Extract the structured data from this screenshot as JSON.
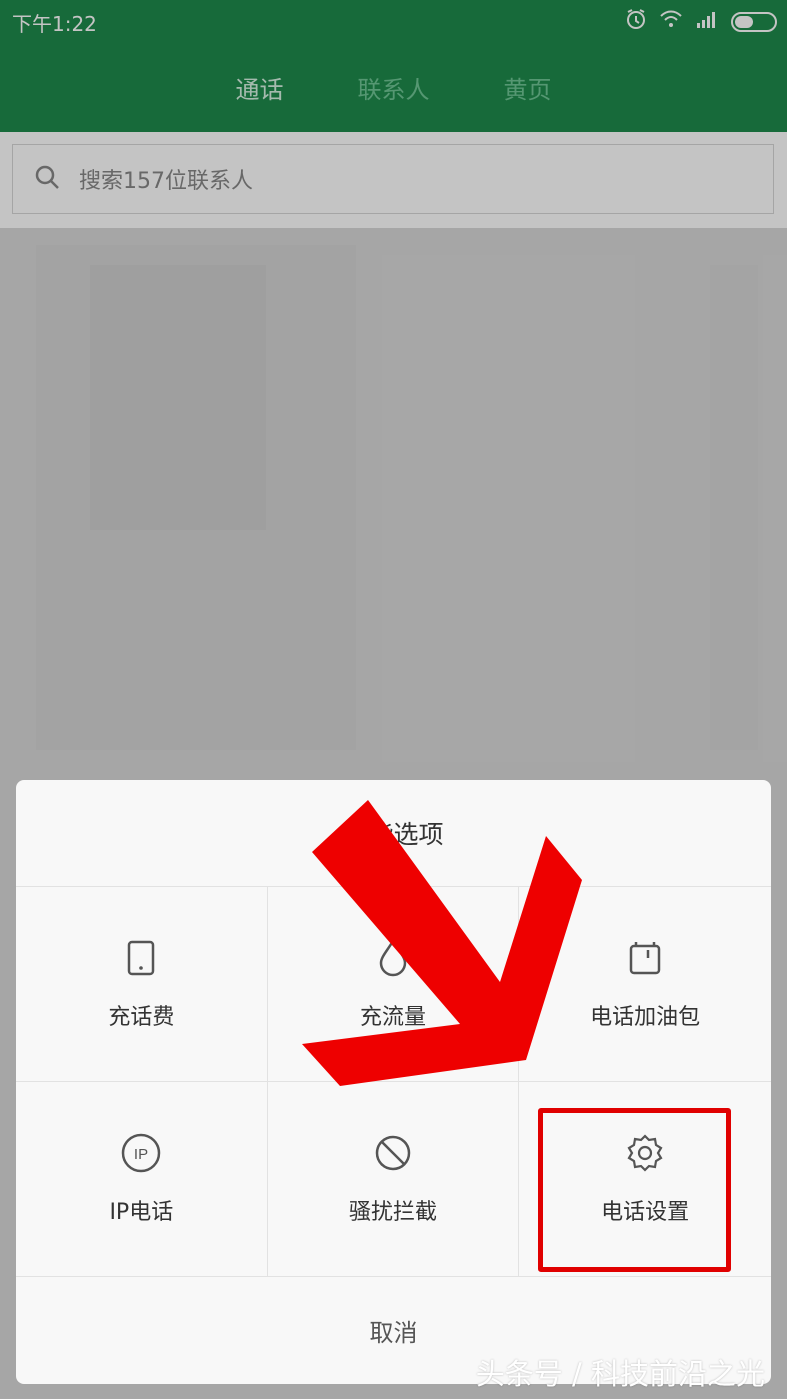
{
  "status_bar": {
    "time": "下午1:22",
    "icons": [
      "alarm-icon",
      "wifi-icon",
      "signal-icon",
      "battery-icon"
    ]
  },
  "tabs": [
    {
      "label": "通话",
      "active": true
    },
    {
      "label": "联系人",
      "active": false
    },
    {
      "label": "黄页",
      "active": false
    }
  ],
  "search": {
    "placeholder": "搜索157位联系人",
    "icon": "search-icon"
  },
  "dialog": {
    "title": "功能选项",
    "options": [
      {
        "label": "充话费",
        "icon": "phone-card-icon"
      },
      {
        "label": "充流量",
        "icon": "water-drop-icon"
      },
      {
        "label": "电话加油包",
        "icon": "package-icon"
      },
      {
        "label": "IP电话",
        "icon": "ip-icon"
      },
      {
        "label": "骚扰拦截",
        "icon": "block-icon"
      },
      {
        "label": "电话设置",
        "icon": "gear-icon"
      }
    ],
    "cancel": "取消"
  },
  "annotation": {
    "arrow": "red-arrow",
    "highlight": "电话设置"
  },
  "watermark": "头条号 / 科技前沿之光",
  "colors": {
    "green": "#1f8b4c",
    "red": "#e00000"
  }
}
